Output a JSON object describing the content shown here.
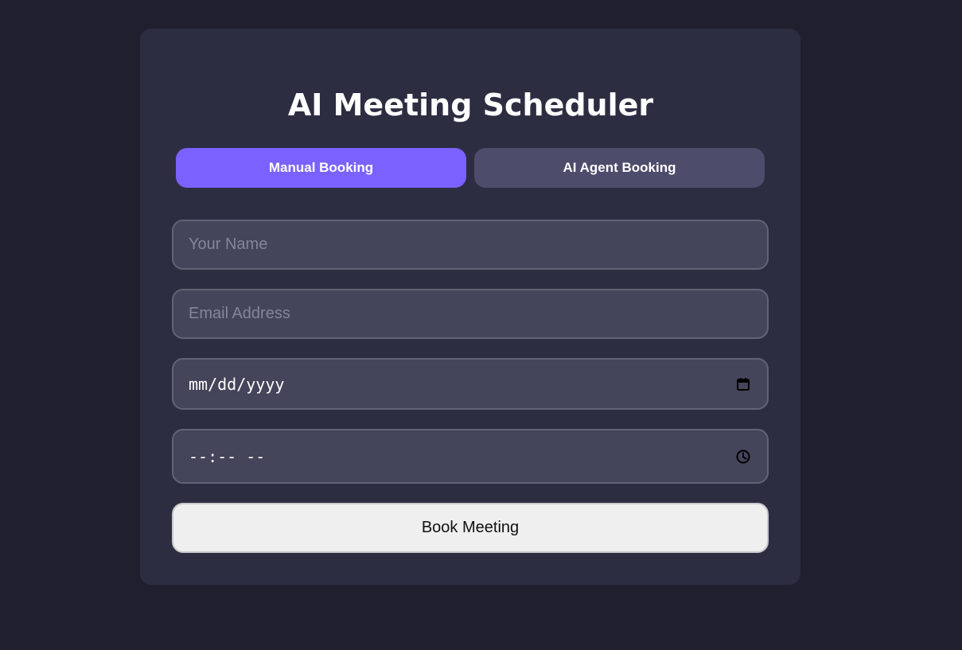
{
  "app": {
    "title": "AI Meeting Scheduler"
  },
  "tabs": [
    {
      "label": "Manual Booking",
      "active": true
    },
    {
      "label": "AI Agent Booking",
      "active": false
    }
  ],
  "form": {
    "name_placeholder": "Your Name",
    "email_placeholder": "Email Address",
    "date_placeholder": "mm/dd/yyyy",
    "time_placeholder": "--:-- --",
    "submit_label": "Book Meeting",
    "icons": {
      "date": "calendar-icon",
      "time": "clock-icon"
    }
  },
  "colors": {
    "page_background": "#1f1f2e",
    "card_background": "#2d2d42",
    "active_tab": "#7b61ff",
    "inactive_tab": "#4d4c6b",
    "field_background": "#44445a",
    "field_border": "#636376",
    "button_background": "#efefef"
  }
}
